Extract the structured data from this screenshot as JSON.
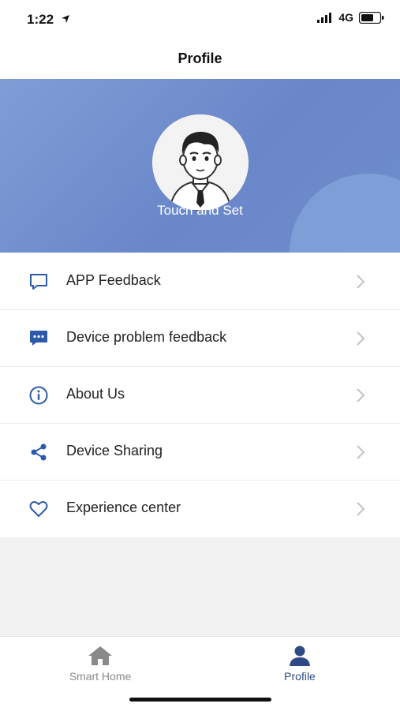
{
  "status_bar": {
    "time": "1:22",
    "network": "4G"
  },
  "header": {
    "title": "Profile"
  },
  "banner": {
    "avatar_icon": "user-avatar",
    "label": "Touch and Set"
  },
  "menu": {
    "items": [
      {
        "label": "APP Feedback",
        "icon": "chat-bubble-icon"
      },
      {
        "label": "Device problem feedback",
        "icon": "message-dots-icon"
      },
      {
        "label": "About Us",
        "icon": "info-icon"
      },
      {
        "label": "Device Sharing",
        "icon": "share-icon"
      },
      {
        "label": "Experience center",
        "icon": "heart-icon"
      }
    ]
  },
  "tabbar": {
    "tabs": [
      {
        "label": "Smart Home",
        "icon": "home-icon",
        "active": false
      },
      {
        "label": "Profile",
        "icon": "person-icon",
        "active": true
      }
    ]
  },
  "colors": {
    "accent": "#2f4a86",
    "banner_start": "#7f9ed6",
    "banner_end": "#6a87c9",
    "icon_blue": "#2d5aa8"
  }
}
